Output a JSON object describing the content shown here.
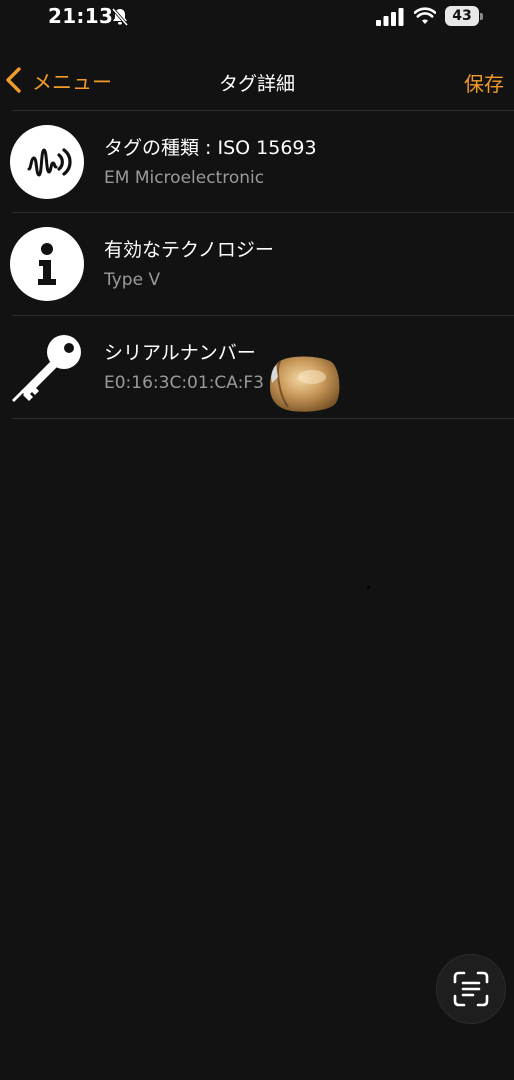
{
  "status_bar": {
    "time": "21:13",
    "battery": "43",
    "icons": [
      "bell-muted-icon",
      "signal-icon",
      "wifi-icon",
      "battery-icon"
    ]
  },
  "nav": {
    "back_label": "メニュー",
    "title": "タグ詳細",
    "save_label": "保存",
    "accent_color": "#f39a2a"
  },
  "rows": [
    {
      "icon": "nfc-tag-icon",
      "title": "タグの種類 : ISO 15693",
      "subtitle": "EM Microelectronic"
    },
    {
      "icon": "info-icon",
      "title": "有効なテクノロジー",
      "subtitle": "Type V"
    },
    {
      "icon": "key-icon",
      "title": "シリアルナンバー",
      "subtitle": "E0:16:3C:01:CA:F3"
    }
  ],
  "fab": {
    "icon": "scan-text-icon"
  },
  "colors": {
    "background": "#121212",
    "text_primary": "#ffffff",
    "text_secondary": "#9a9a9a",
    "divider": "#2d2d2d"
  }
}
